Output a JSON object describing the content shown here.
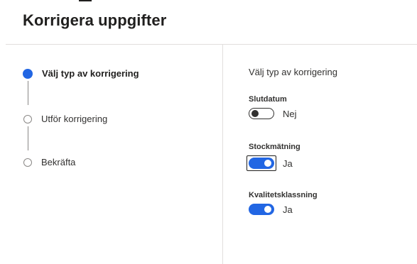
{
  "page": {
    "title": "Korrigera uppgifter"
  },
  "steps": [
    {
      "label": "Välj typ av korrigering",
      "state": "active"
    },
    {
      "label": "Utför korrigering",
      "state": "pending"
    },
    {
      "label": "Bekräfta",
      "state": "pending"
    }
  ],
  "panel": {
    "title": "Välj typ av korrigering",
    "fields": [
      {
        "label": "Slutdatum",
        "value": "Nej",
        "on": false
      },
      {
        "label": "Stockmätning",
        "value": "Ja",
        "on": true
      },
      {
        "label": "Kvalitetsklassning",
        "value": "Ja",
        "on": true
      }
    ]
  },
  "colors": {
    "accent": "#2266e3",
    "text": "#201f1e",
    "divider": "#e1dfdd"
  }
}
